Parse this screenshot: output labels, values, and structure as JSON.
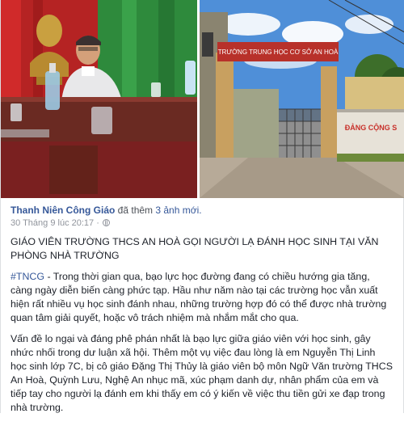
{
  "photos": {
    "right_sign_text": "TRƯỜNG TRUNG HỌC CƠ SỞ AN HOÀ",
    "wall_text": "ĐẢNG CỘNG S"
  },
  "post": {
    "author": "Thanh Niên Công Giáo",
    "action": "đã thêm",
    "photo_count": "3 ảnh mới.",
    "timestamp": "30 Tháng 9 lúc 20:17 ·",
    "headline": "GIÁO VIÊN TRƯỜNG THCS AN HOÀ GỌI NGƯỜI LẠ ĐÁNH HỌC SINH TẠI VĂN PHÒNG NHÀ TRƯỜNG",
    "hashtag": "#TNCG",
    "paragraph1": " - Trong thời gian qua, bạo lực học đường đang có chiều hướng gia tăng, càng ngày diễn biến càng phức tạp. Hầu như năm nào tại các trường học vẫn xuất hiện rất nhiều vụ học sinh đánh nhau, những trường hợp đó có thể được nhà trường quan tâm giải quyết, hoặc vô trách nhiệm mà nhắm mắt cho qua.",
    "paragraph2": "Vấn đề lo ngại và đáng phê phán nhất là bạo lực giữa giáo viên với học sinh, gây nhức nhối trong dư luận xã hội. Thêm một vụ việc đau lòng là em Nguyễn Thị Linh học sinh lớp 7C, bị cô giáo Đặng Thị Thủy là giáo viên bộ môn Ngữ Văn trường THCS An Hoà, Quỳnh Lưu, Nghệ An nhục mã, xúc phạm danh dự, nhân phẩm của em và tiếp tay cho người lạ đánh em khi thấy em có ý kiến về việc thu tiền gửi xe đạp trong nhà trường."
  }
}
